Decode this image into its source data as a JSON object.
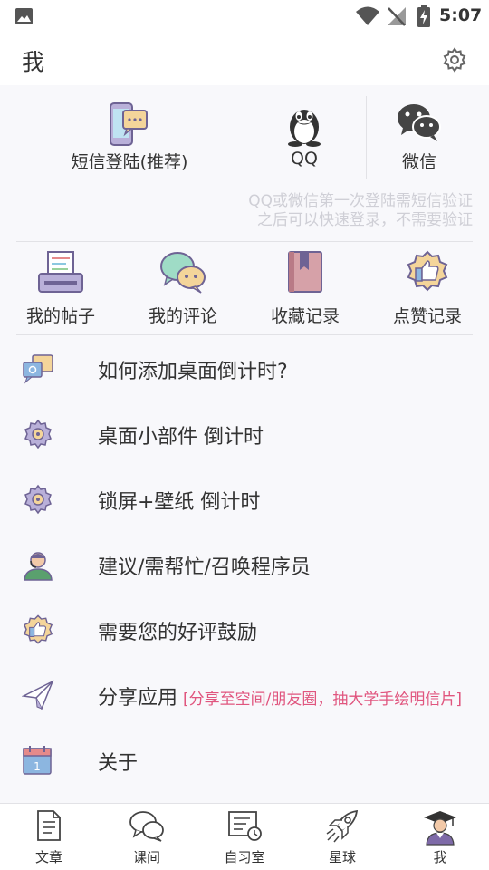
{
  "status_bar": {
    "time": "5:07"
  },
  "header": {
    "title": "我"
  },
  "login": {
    "sms_label": "短信登陆(推荐)",
    "qq_label": "QQ",
    "wechat_label": "微信",
    "note_line1": "QQ或微信第一次登陆需短信验证",
    "note_line2": "之后可以快速登录，不需要验证"
  },
  "quick_actions": [
    {
      "label": "我的帖子",
      "icon": "posts-icon"
    },
    {
      "label": "我的评论",
      "icon": "comments-icon"
    },
    {
      "label": "收藏记录",
      "icon": "bookmark-book-icon"
    },
    {
      "label": "点赞记录",
      "icon": "thumbs-up-badge-icon"
    }
  ],
  "menu": [
    {
      "label": "如何添加桌面倒计时?",
      "icon": "qa-chat-icon"
    },
    {
      "label": "桌面小部件 倒计时",
      "icon": "gear-icon"
    },
    {
      "label": "锁屏+壁纸 倒计时",
      "icon": "gear-icon"
    },
    {
      "label": "建议/需帮忙/召唤程序员",
      "icon": "support-agent-icon"
    },
    {
      "label": "需要您的好评鼓励",
      "icon": "thumbs-up-badge-icon"
    },
    {
      "label": "分享应用",
      "extra": "[分享至空间/朋友圈，抽大学手绘明信片]",
      "icon": "paper-plane-icon"
    },
    {
      "label": "关于",
      "icon": "calendar-icon"
    }
  ],
  "tabs": [
    {
      "label": "文章",
      "icon": "document-icon"
    },
    {
      "label": "课间",
      "icon": "chat-bubbles-icon"
    },
    {
      "label": "自习室",
      "icon": "study-room-icon"
    },
    {
      "label": "星球",
      "icon": "rocket-icon"
    },
    {
      "label": "我",
      "icon": "graduate-avatar-icon",
      "active": true
    }
  ],
  "colors": {
    "accent_pink": "#e0557e",
    "icon_purple": "#7e6aa8",
    "note_gray": "#cfcfd6"
  }
}
